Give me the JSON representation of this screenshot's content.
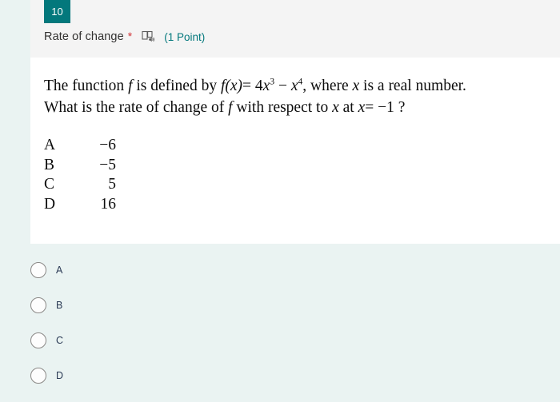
{
  "question": {
    "number": "10",
    "title": "Rate of change",
    "required_marker": "*",
    "points_label": "(1 Point)",
    "reader_icon": "immersive-reader-icon",
    "accent_color": "#03787c",
    "required_color": "#d13438",
    "header_background": "#f4f4f4",
    "page_background": "#eaf3f2",
    "body_background": "#ffffff"
  },
  "stem": {
    "line1_part1": "The function",
    "line1_f": "f",
    "line1_part2": "is defined by",
    "line1_fx": "f",
    "line1_paren_x": "(x)",
    "line1_equals": "= 4",
    "line1_x1": "x",
    "line1_exp1": "3",
    "line1_minus": " − ",
    "line1_x2": "x",
    "line1_exp2": "4",
    "line1_tail": ", where",
    "line1_x3": "x",
    "line1_end": "is a real number.",
    "line2_part1": "What is the rate of change of",
    "line2_f": "f",
    "line2_part2": "with respect to",
    "line2_x1": "x",
    "line2_part3": "at",
    "line2_x2": "x",
    "line2_eq": "= −1 ?"
  },
  "choices": [
    {
      "letter": "A",
      "value": "−6"
    },
    {
      "letter": "B",
      "value": "−5"
    },
    {
      "letter": "C",
      "value": "5"
    },
    {
      "letter": "D",
      "value": "16"
    }
  ],
  "answer_options": [
    {
      "label": "A",
      "selected": false
    },
    {
      "label": "B",
      "selected": false
    },
    {
      "label": "C",
      "selected": false
    },
    {
      "label": "D",
      "selected": false
    }
  ]
}
